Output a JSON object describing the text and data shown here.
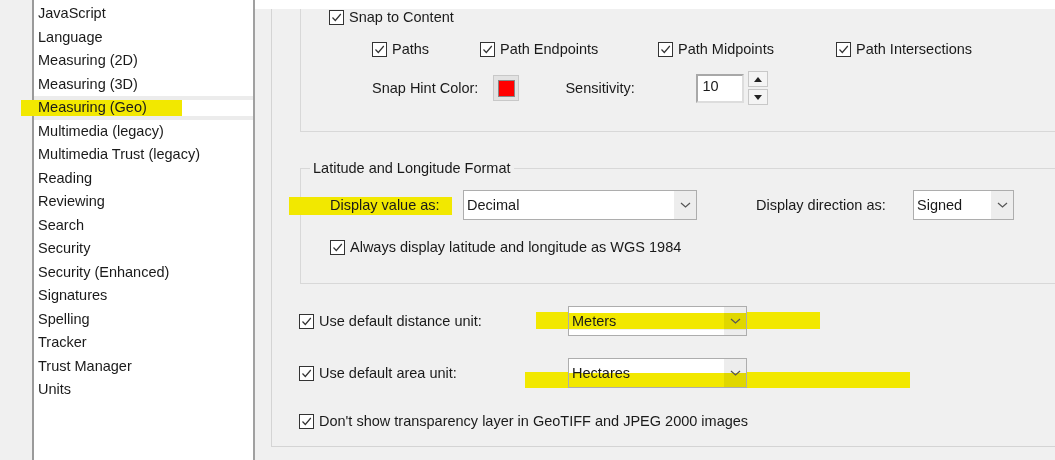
{
  "sidebar": {
    "items": [
      {
        "label": "JavaScript",
        "selected": false,
        "highlighted": false
      },
      {
        "label": "Language",
        "selected": false,
        "highlighted": false
      },
      {
        "label": "Measuring (2D)",
        "selected": false,
        "highlighted": false
      },
      {
        "label": "Measuring (3D)",
        "selected": false,
        "highlighted": false
      },
      {
        "label": "Measuring (Geo)",
        "selected": true,
        "highlighted": true
      },
      {
        "label": "Multimedia (legacy)",
        "selected": false,
        "highlighted": false
      },
      {
        "label": "Multimedia Trust (legacy)",
        "selected": false,
        "highlighted": false
      },
      {
        "label": "Reading",
        "selected": false,
        "highlighted": false
      },
      {
        "label": "Reviewing",
        "selected": false,
        "highlighted": false
      },
      {
        "label": "Search",
        "selected": false,
        "highlighted": false
      },
      {
        "label": "Security",
        "selected": false,
        "highlighted": false
      },
      {
        "label": "Security (Enhanced)",
        "selected": false,
        "highlighted": false
      },
      {
        "label": "Signatures",
        "selected": false,
        "highlighted": false
      },
      {
        "label": "Spelling",
        "selected": false,
        "highlighted": false
      },
      {
        "label": "Tracker",
        "selected": false,
        "highlighted": false
      },
      {
        "label": "Trust Manager",
        "selected": false,
        "highlighted": false
      },
      {
        "label": "Units",
        "selected": false,
        "highlighted": false
      }
    ]
  },
  "snap": {
    "snap_to_content": {
      "label": "Snap to Content",
      "checked": true
    },
    "options": [
      {
        "label": "Paths",
        "checked": true
      },
      {
        "label": "Path Endpoints",
        "checked": true
      },
      {
        "label": "Path Midpoints",
        "checked": true
      },
      {
        "label": "Path Intersections",
        "checked": true
      }
    ],
    "hint_color_label": "Snap Hint Color:",
    "sensitivity_label": "Sensitivity:",
    "sensitivity": "10"
  },
  "lat_long": {
    "title": "Latitude and Longitude Format",
    "display_value": {
      "label": "Display value as:",
      "value": "Decimal",
      "highlighted": true
    },
    "display_direction": {
      "label": "Display direction as:",
      "value": "Signed"
    },
    "wgs": {
      "label": "Always display latitude and longitude as WGS 1984",
      "checked": true
    }
  },
  "units": [
    {
      "kind": "dropdown",
      "label": "Use default distance unit:",
      "checked": true,
      "value": "Meters",
      "highlighted": true
    },
    {
      "kind": "dropdown",
      "label": "Use default area unit:",
      "checked": true,
      "value": "Hectares",
      "highlighted": true
    },
    {
      "kind": "checkbox",
      "label": "Don't show transparency layer in GeoTIFF and JPEG 2000 images",
      "checked": true
    }
  ]
}
